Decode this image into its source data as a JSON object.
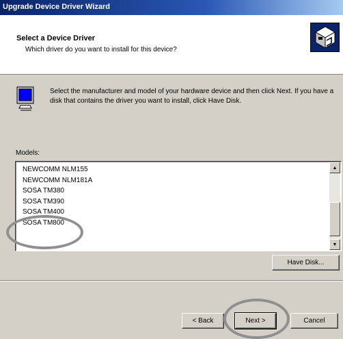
{
  "window": {
    "title": "Upgrade Device Driver Wizard"
  },
  "header": {
    "title": "Select a Device Driver",
    "subtitle": "Which driver do you want to install for this device?",
    "icon": "wizard-device-icon"
  },
  "body": {
    "icon": "monitor-icon",
    "instructions": "Select the manufacturer and model of your hardware device and then click Next. If you have a disk that contains the driver you want to install, click Have Disk."
  },
  "models": {
    "label": "Models:",
    "items": [
      "NEWCOMM NLM155",
      "NEWCOMM NLM181A",
      "SOSA TM380",
      "SOSA TM390",
      "SOSA TM400",
      "SOSA TM800"
    ],
    "scroll_up_icon": "scroll-up-arrow-icon",
    "scroll_down_icon": "scroll-down-arrow-icon"
  },
  "buttons": {
    "have_disk": "Have Disk...",
    "back": "< Back",
    "next": "Next >",
    "cancel": "Cancel"
  },
  "annotations": {
    "color": "#8f8f8f"
  }
}
